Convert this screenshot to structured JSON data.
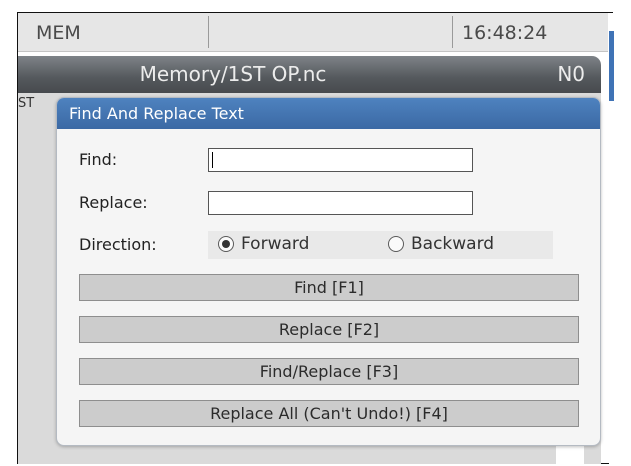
{
  "status_bar": {
    "mode": "MEM",
    "time": "16:48:24"
  },
  "program_header": {
    "title": "Memory/1ST OP.nc",
    "n_number": "N0"
  },
  "editor": {
    "partial_text": "ST"
  },
  "dialog": {
    "title": "Find And Replace Text",
    "find_label": "Find:",
    "find_value": "",
    "replace_label": "Replace:",
    "replace_value": "",
    "direction_label": "Direction:",
    "direction_options": [
      {
        "label": "Forward",
        "selected": true
      },
      {
        "label": "Backward",
        "selected": false
      }
    ],
    "buttons": [
      {
        "label": "Find [F1]"
      },
      {
        "label": "Replace [F2]"
      },
      {
        "label": "Find/Replace [F3]"
      },
      {
        "label": "Replace All (Can't Undo!) [F4]"
      }
    ]
  },
  "colors": {
    "dialog_header": "#4a7cba",
    "title_bar": "#5a5e62",
    "status_bar": "#e6e6e6"
  }
}
